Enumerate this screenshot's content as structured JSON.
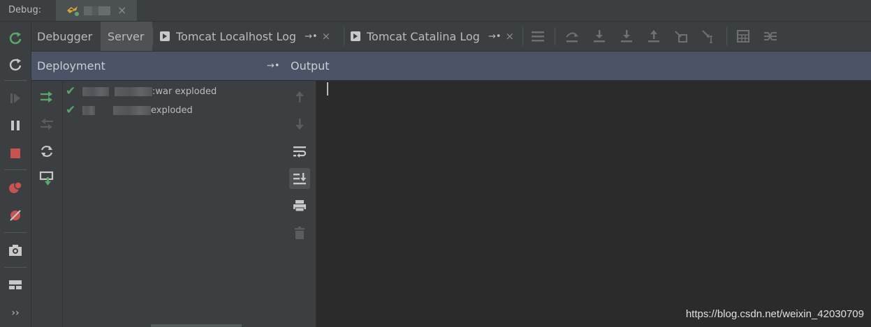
{
  "debug_bar": {
    "label": "Debug:",
    "run_tab_close": "×"
  },
  "tabs": [
    {
      "label": "Debugger",
      "active": false
    },
    {
      "label": "Server",
      "active": true
    },
    {
      "label": "Tomcat Localhost Log",
      "pin": "→•",
      "close": "×"
    },
    {
      "label": "Tomcat Catalina Log",
      "pin": "→•",
      "close": "×"
    }
  ],
  "deployment": {
    "title": "Deployment",
    "pin": "→•",
    "items": [
      {
        "suffix": ":war exploded",
        "status": "deployed"
      },
      {
        "suffix": " exploded",
        "status": "deployed"
      }
    ]
  },
  "output": {
    "title": "Output",
    "content": ""
  },
  "watermark": "https://blog.csdn.net/weixin_42030709",
  "colors": {
    "accent_green": "#59a869",
    "stop_red": "#c75450",
    "header_bg": "#4b5466",
    "panel_bg": "#3c3f41",
    "console_bg": "#2b2b2b"
  },
  "icons": {
    "left_toolbar": [
      "rerun-icon",
      "restart-icon",
      "resume-icon",
      "pause-icon",
      "stop-icon",
      "view-breakpoints-icon",
      "mute-breakpoints-icon",
      "camera-icon",
      "layout-icon",
      "more-icon"
    ],
    "tab_toolbar": [
      "menu-icon",
      "step-over-icon",
      "step-into-icon",
      "force-step-into-icon",
      "step-out-icon",
      "drop-frame-icon",
      "run-to-cursor-icon",
      "evaluate-icon",
      "trace-icon"
    ],
    "deploy_actions": [
      "deploy-all-icon",
      "undeploy-icon",
      "redeploy-icon",
      "deploy-artifact-icon"
    ],
    "output_tools": [
      "scroll-up-icon",
      "scroll-down-icon",
      "soft-wrap-icon",
      "scroll-to-end-icon",
      "print-icon",
      "clear-all-icon"
    ]
  }
}
